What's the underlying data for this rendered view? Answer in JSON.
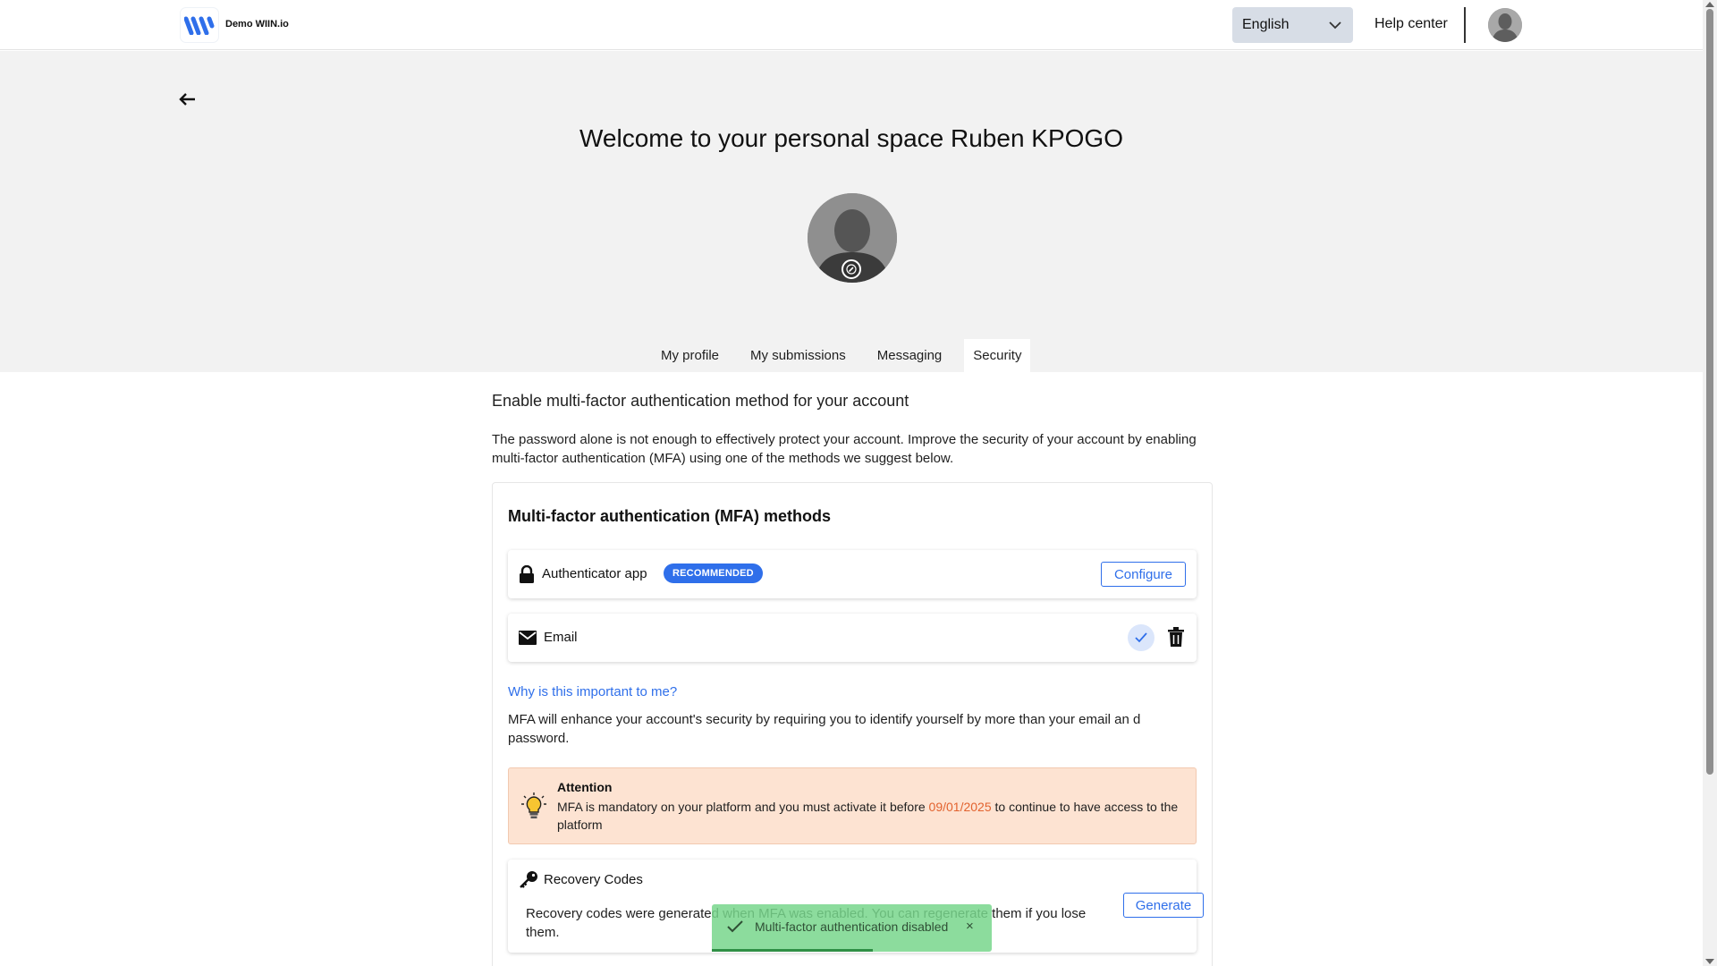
{
  "header": {
    "brand": "Demo WIIN.io",
    "language": "English",
    "help": "Help center"
  },
  "hero": {
    "welcome": "Welcome to your personal space Ruben KPOGO"
  },
  "tabs": [
    {
      "label": "My profile"
    },
    {
      "label": "My submissions"
    },
    {
      "label": "Messaging"
    },
    {
      "label": "Security",
      "active": true
    }
  ],
  "security": {
    "title": "Enable multi-factor authentication method for your account",
    "description": "The password alone is not enough to effectively protect your account. Improve the security of your account by enabling multi-factor authentication (MFA) using one of the methods we suggest below.",
    "card_title": "Multi-factor authentication (MFA) methods",
    "methods": [
      {
        "label": "Authenticator app",
        "badge": "RECOMMENDED",
        "action": "Configure",
        "icon": "lock-icon"
      },
      {
        "label": "Email",
        "icon": "envelope-icon",
        "status": "enabled"
      }
    ],
    "why_link": "Why is this important to me?",
    "why_text": "MFA will enhance your account's security by requiring you to identify yourself by more than your email an d password.",
    "attention": {
      "title": "Attention",
      "text_before": "MFA is mandatory on your platform and you must activate it before ",
      "date": "09/01/2025",
      "text_after": " to continue to have access to the platform",
      "date_color": "#e2622e"
    },
    "recovery": {
      "title": "Recovery Codes",
      "text": "Recovery codes were generated when MFA was enabled. You can regenerate them if you lose them.",
      "action": "Generate"
    }
  },
  "toast": {
    "message": "Multi-factor authentication disabled",
    "close": "×"
  },
  "colors": {
    "accent": "#2f6fea",
    "hero_bg": "#f2f2f2",
    "attention_bg": "#fde3d2",
    "toast_bg": "#78d68c"
  }
}
